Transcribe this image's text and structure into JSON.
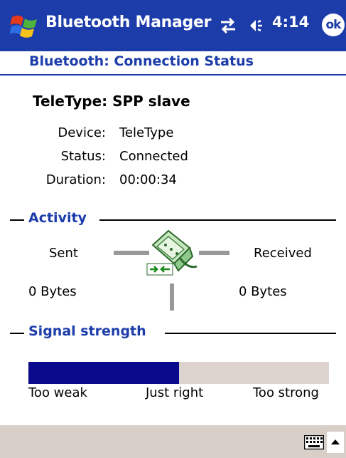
{
  "titlebar": {
    "app_title": "Bluetooth Manager",
    "time": "4:14",
    "ok_label": "ok"
  },
  "header": {
    "title": "Bluetooth: Connection Status"
  },
  "connection": {
    "title": "TeleType: SPP slave",
    "rows": [
      {
        "label": "Device:",
        "value": "TeleType"
      },
      {
        "label": "Status:",
        "value": "Connected"
      },
      {
        "label": "Duration:",
        "value": "00:00:34"
      }
    ]
  },
  "activity": {
    "section_title": "Activity",
    "sent_label": "Sent",
    "received_label": "Received",
    "sent_bytes": "0 Bytes",
    "received_bytes": "0 Bytes"
  },
  "signal": {
    "section_title": "Signal strength",
    "level_fraction": 0.5,
    "labels": {
      "weak": "Too weak",
      "right": "Just right",
      "strong": "Too strong"
    }
  },
  "colors": {
    "brand": "#1c3caa",
    "signal_fill": "#0a0a8c",
    "signal_track": "#dcd3cf"
  },
  "icons": {
    "start": "windows-flag-icon",
    "connectivity": "connectivity-arrows-icon",
    "volume": "speaker-icon",
    "serial": "serial-port-connector-icon",
    "keyboard": "keyboard-icon"
  }
}
